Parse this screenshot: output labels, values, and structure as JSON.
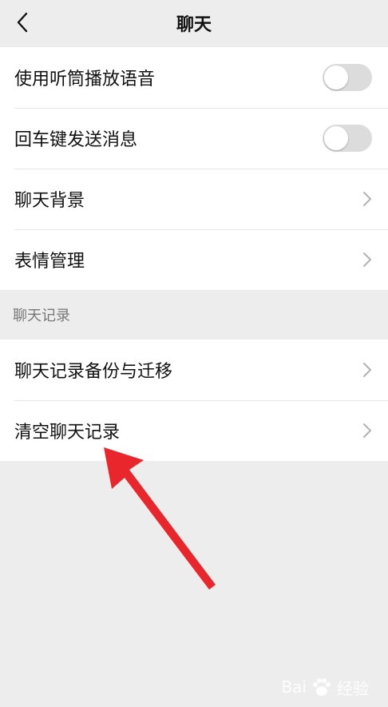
{
  "header": {
    "title": "聊天"
  },
  "group1": {
    "toggle_rows": [
      {
        "label": "使用听筒播放语音",
        "enabled": false
      },
      {
        "label": "回车键发送消息",
        "enabled": false
      }
    ],
    "link_rows": [
      {
        "label": "聊天背景"
      },
      {
        "label": "表情管理"
      }
    ]
  },
  "section": {
    "title": "聊天记录"
  },
  "group2": {
    "rows": [
      {
        "label": "聊天记录备份与迁移"
      },
      {
        "label": "清空聊天记录"
      }
    ]
  },
  "annotation": {
    "arrow_color": "#e8262b"
  },
  "watermark": {
    "brand_prefix": "Bai",
    "brand_suffix": "经验"
  },
  "icons": [
    "back-chevron-icon",
    "chevron-right-icon",
    "red-arrow-annotation",
    "baidu-paw-icon"
  ]
}
